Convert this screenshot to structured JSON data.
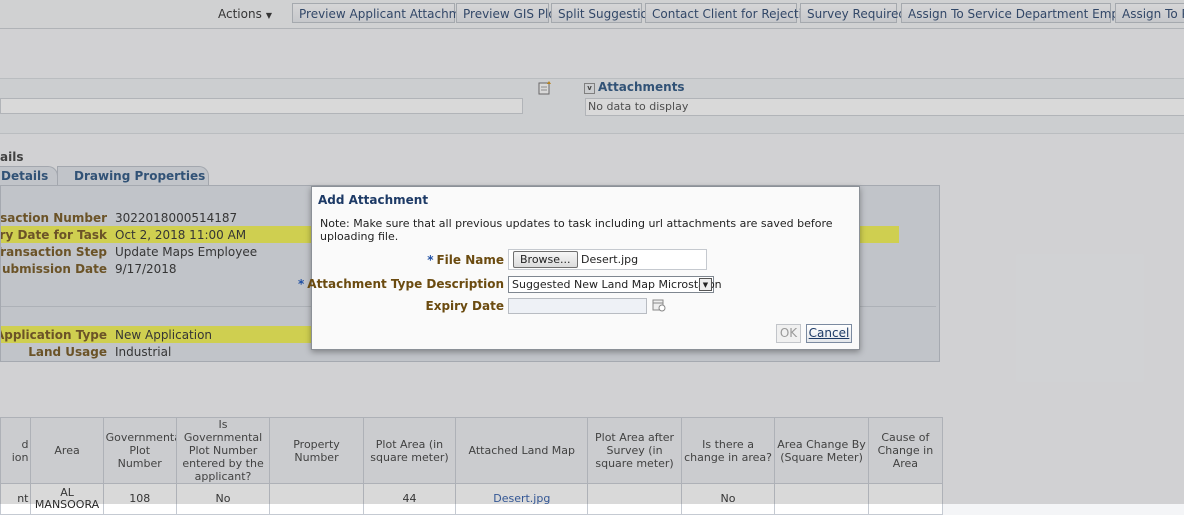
{
  "toolbar": {
    "actions_label": "Actions",
    "buttons": [
      "Preview Applicant Attachments",
      "Preview GIS Plot",
      "Split Suggestion",
      "Contact Client for Rejection",
      "Survey Required",
      "Assign To Service Department Employee",
      "Assign To Pla"
    ]
  },
  "attachments": {
    "title": "Attachments",
    "empty_text": "No data to display"
  },
  "section_label": "ails",
  "tabs": [
    "Details",
    "Drawing Properties"
  ],
  "details": {
    "fields": [
      {
        "label": "ransaction Number",
        "value": "3022018000514187"
      },
      {
        "label": "very Date for Task",
        "value": "Oct 2, 2018 11:00 AM"
      },
      {
        "label": "Transaction Step",
        "value": "Update Maps Employee"
      },
      {
        "label": "on Submission Date",
        "value": "9/17/2018"
      }
    ],
    "fields2": [
      {
        "label": "Application Type",
        "value": "New Application"
      },
      {
        "label": "Land Usage",
        "value": "Industrial"
      }
    ]
  },
  "table": {
    "columns": [
      "d\nion",
      "Area",
      "Governmental Plot Number",
      "Is Governmental Plot Number entered by the applicant?",
      "Property Number",
      "Plot Area (in square meter)",
      "Attached Land Map",
      "Plot Area after Survey (in square meter)",
      "Is there a change in area?",
      "Area Change By (Square Meter)",
      "Cause of Change in Area"
    ],
    "rows": [
      [
        "nt",
        "AL MANSOORA",
        "108",
        "No",
        "",
        "44",
        "Desert.jpg",
        "",
        "No",
        "",
        ""
      ]
    ]
  },
  "dialog": {
    "title": "Add Attachment",
    "note": "Note: Make sure that all previous updates to task including url attachments are saved before uploading file.",
    "file_name_label": "File Name",
    "browse_label": "Browse...",
    "file_name_value": "Desert.jpg",
    "type_label": "Attachment Type Description",
    "type_value": "Suggested New Land Map Microstaion",
    "expiry_label": "Expiry Date",
    "ok_label": "OK",
    "cancel_label": "Cancel",
    "required_marker": "*"
  },
  "colors": {
    "highlight": "#f2f247",
    "label_brown": "#6b4b10",
    "link_blue": "#1f4fa3"
  }
}
